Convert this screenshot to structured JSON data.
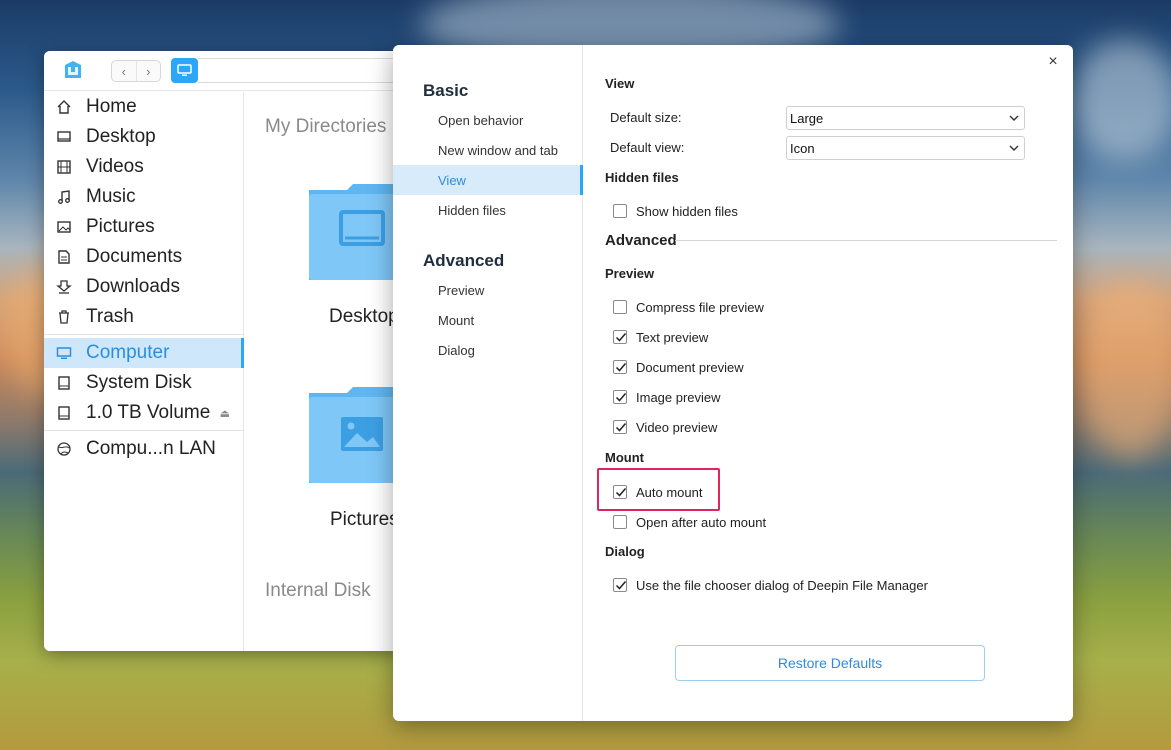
{
  "file_manager": {
    "sidebar": {
      "items": [
        {
          "label": "Home",
          "icon": "home-icon"
        },
        {
          "label": "Desktop",
          "icon": "desktop-icon"
        },
        {
          "label": "Videos",
          "icon": "videos-icon"
        },
        {
          "label": "Music",
          "icon": "music-icon"
        },
        {
          "label": "Pictures",
          "icon": "pictures-icon"
        },
        {
          "label": "Documents",
          "icon": "documents-icon"
        },
        {
          "label": "Downloads",
          "icon": "downloads-icon"
        },
        {
          "label": "Trash",
          "icon": "trash-icon"
        }
      ],
      "devices": [
        {
          "label": "Computer",
          "icon": "computer-icon",
          "active": true
        },
        {
          "label": "System Disk",
          "icon": "disk-icon"
        },
        {
          "label": "1.0 TB Volume",
          "icon": "disk-icon",
          "eject": true
        }
      ],
      "network": [
        {
          "label": "Compu...n LAN",
          "icon": "network-icon"
        }
      ]
    },
    "content": {
      "section_my_directories": "My Directories",
      "folders": [
        "Desktop",
        "Pictures"
      ],
      "section_internal_disk": "Internal Disk"
    }
  },
  "settings_dialog": {
    "nav": {
      "basic_title": "Basic",
      "basic_items": [
        "Open behavior",
        "New window and tab",
        "View",
        "Hidden files"
      ],
      "active_item": "View",
      "advanced_title": "Advanced",
      "advanced_items": [
        "Preview",
        "Mount",
        "Dialog"
      ]
    },
    "view": {
      "title": "View",
      "default_size_label": "Default size:",
      "default_size_value": "Large",
      "default_view_label": "Default view:",
      "default_view_value": "Icon"
    },
    "hidden_files": {
      "title": "Hidden files",
      "show_hidden_label": "Show hidden files",
      "show_hidden_checked": false
    },
    "advanced_title": "Advanced",
    "preview": {
      "title": "Preview",
      "options": [
        {
          "label": "Compress file preview",
          "checked": false
        },
        {
          "label": "Text preview",
          "checked": true
        },
        {
          "label": "Document preview",
          "checked": true
        },
        {
          "label": "Image preview",
          "checked": true
        },
        {
          "label": "Video preview",
          "checked": true
        }
      ]
    },
    "mount": {
      "title": "Mount",
      "options": [
        {
          "label": "Auto mount",
          "checked": true
        },
        {
          "label": "Open after auto mount",
          "checked": false
        }
      ]
    },
    "dialog": {
      "title": "Dialog",
      "options": [
        {
          "label": "Use the file chooser dialog of Deepin File Manager",
          "checked": true
        }
      ]
    },
    "restore_label": "Restore Defaults",
    "close_label": "×",
    "colors": {
      "accent": "#2ca7f8",
      "highlight": "#e0245e"
    }
  }
}
